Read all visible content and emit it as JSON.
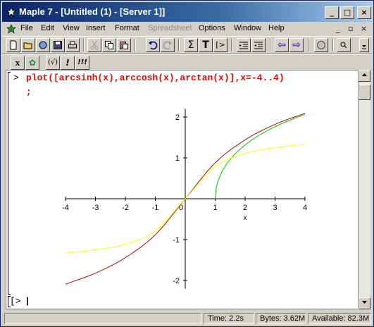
{
  "window": {
    "title": "Maple 7  - [Untitled (1) - [Server 1]]"
  },
  "caption_buttons": {
    "minimize": "_",
    "maximize": "□",
    "close": "×"
  },
  "menu": {
    "items": [
      {
        "label": "File",
        "enabled": true
      },
      {
        "label": "Edit",
        "enabled": true
      },
      {
        "label": "View",
        "enabled": true
      },
      {
        "label": "Insert",
        "enabled": true
      },
      {
        "label": "Format",
        "enabled": true
      },
      {
        "label": "Spreadsheet",
        "enabled": false
      },
      {
        "label": "Options",
        "enabled": true
      },
      {
        "label": "Window",
        "enabled": true
      },
      {
        "label": "Help",
        "enabled": true
      }
    ],
    "mdi_minimize": "_",
    "mdi_restore": "▫",
    "mdi_close": "×"
  },
  "toolbar": {
    "sigma": "Σ",
    "text": "T",
    "exec": "[>",
    "back_arrow": "⇦",
    "forward_arrow": "⇨",
    "context": {
      "x_label": "x",
      "maple_leaf": "✿",
      "sqrt_label": "(√)",
      "bang": "!",
      "bangs": "!!!"
    }
  },
  "worksheet": {
    "prompt": ">",
    "command_line1": "plot([arcsinh(x),arccosh(x),arctan(x)],x=-4..4)",
    "command_line2": ";",
    "empty_prompt": "[>",
    "cursor": "|"
  },
  "chart_data": {
    "type": "line",
    "xlabel": "x",
    "ylabel": "",
    "xlim": [
      -4,
      4
    ],
    "ylim": [
      -2.2,
      2.2
    ],
    "x_ticks": [
      -4,
      -3,
      -2,
      -1,
      0,
      1,
      2,
      3,
      4
    ],
    "x_tick_labels": [
      "-4",
      "-3",
      "-2",
      "-1",
      "0",
      "1",
      "2",
      "3",
      "4"
    ],
    "y_ticks": [
      -2,
      -1,
      1,
      2
    ],
    "y_tick_labels": [
      "-2",
      "-1",
      "1",
      "2"
    ],
    "series": [
      {
        "function": "arcsinh",
        "color": "#cc0000",
        "x": [
          -4,
          -3,
          -2,
          -1,
          0,
          1,
          2,
          3,
          4
        ],
        "y": [
          -2.09,
          -1.82,
          -1.44,
          -0.88,
          0,
          0.88,
          1.44,
          1.82,
          2.09
        ]
      },
      {
        "function": "arccosh",
        "color": "#00cc00",
        "x": [
          1,
          1.5,
          2,
          3,
          4
        ],
        "y": [
          0,
          0.96,
          1.32,
          1.76,
          2.06
        ]
      },
      {
        "function": "arctan",
        "color": "#ffff00",
        "x": [
          -4,
          -3,
          -2,
          -1,
          0,
          1,
          2,
          3,
          4
        ],
        "y": [
          -1.33,
          -1.25,
          -1.11,
          -0.79,
          0,
          0.79,
          1.11,
          1.25,
          1.33
        ]
      }
    ]
  },
  "status": {
    "time": "Time:  2.2s",
    "bytes": "Bytes: 3.62M",
    "available": "Available: 82.3M"
  }
}
